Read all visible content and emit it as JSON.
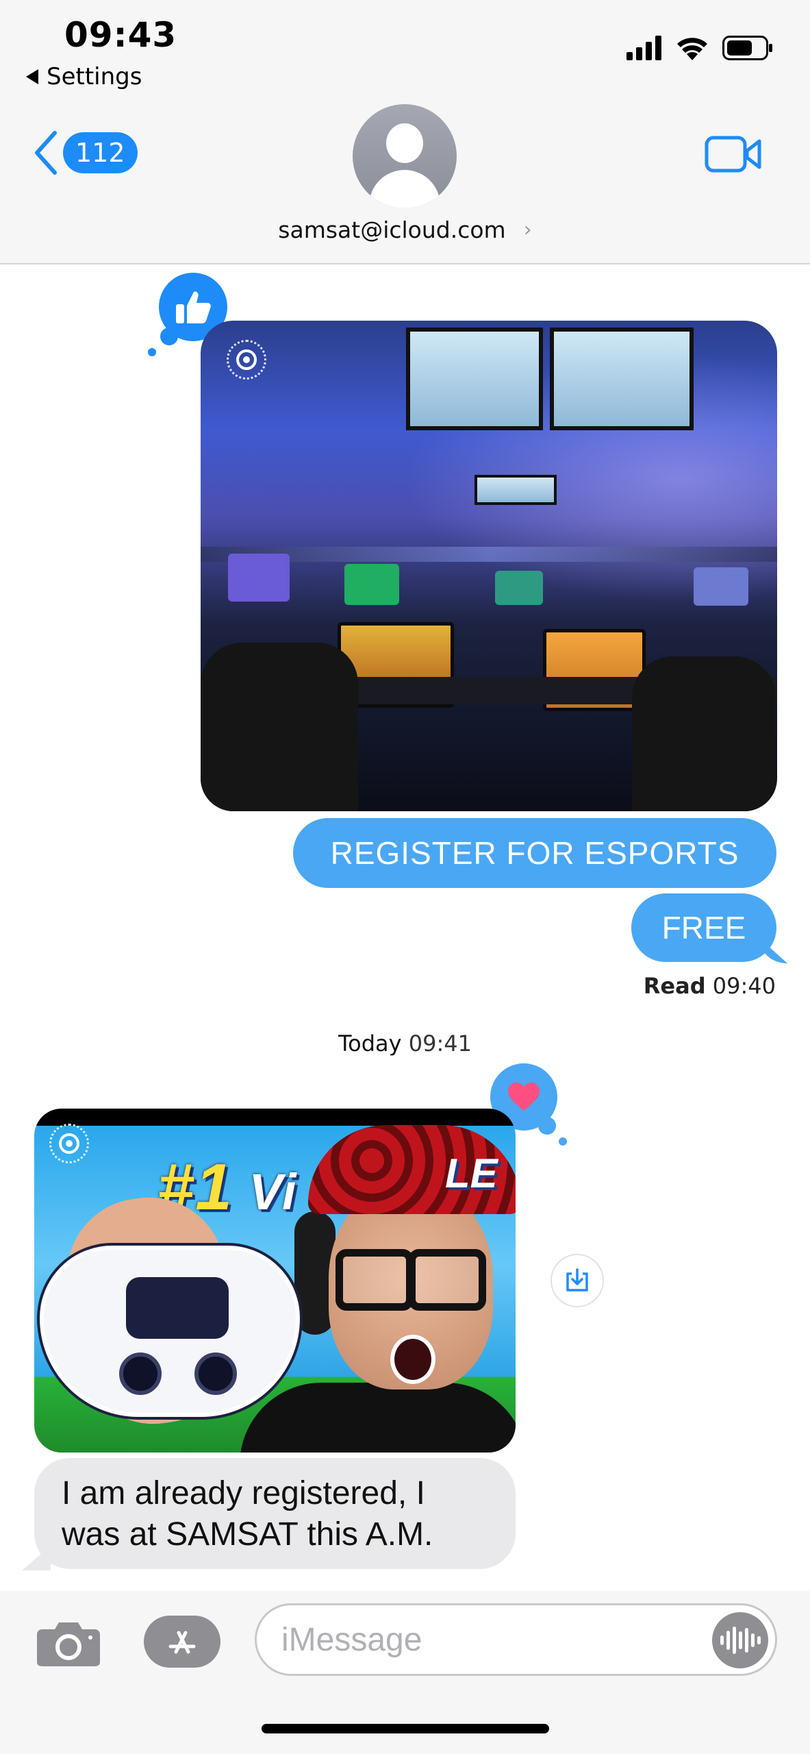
{
  "status_bar": {
    "time": "09:43",
    "back_app": "Settings",
    "icons": [
      "signal-icon",
      "wifi-icon",
      "battery-icon"
    ]
  },
  "header": {
    "unread_count": "112",
    "contact": "samsat@icloud.com",
    "accent_color": "#1d8cf8"
  },
  "messages": {
    "sent_image_tapback": "like",
    "sent_bubbles": [
      "REGISTER FOR ESPORTS",
      "FREE"
    ],
    "read_label": "Read",
    "read_time": "09:40",
    "day_label": "Today",
    "day_time": "09:41",
    "received_image_tapback": "heart",
    "received_text": "I am already registered, I was at SAMSAT this A.M."
  },
  "gamer_thumbnail": {
    "number_text": "#1",
    "title_text": "Vi",
    "title_tail": "LE"
  },
  "composer": {
    "placeholder": "iMessage"
  }
}
